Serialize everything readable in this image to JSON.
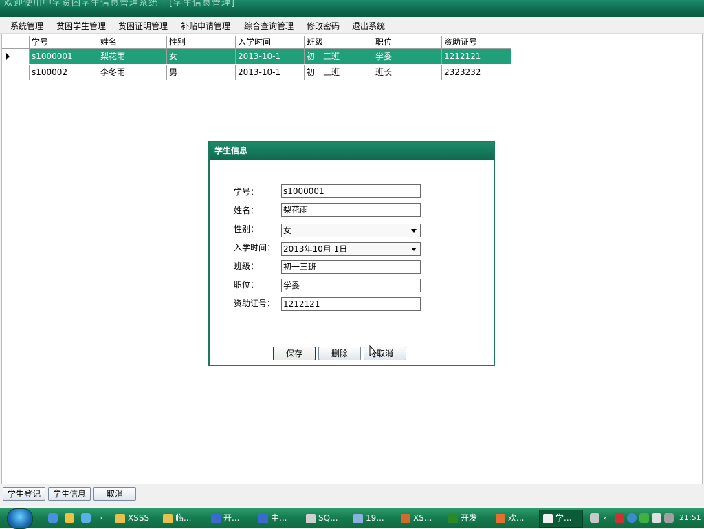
{
  "window": {
    "title": "欢迎使用中学贫困学生信息管理系统 - [学生信息管理]"
  },
  "menu": [
    "系统管理",
    "贫困学生管理",
    "贫困证明管理",
    "补贴申请管理",
    "综合查询管理",
    "修改密码",
    "退出系统"
  ],
  "grid": {
    "columns": [
      "学号",
      "姓名",
      "性别",
      "入学时间",
      "班级",
      "职位",
      "资助证号"
    ],
    "rows": [
      [
        "s1000001",
        "梨花雨",
        "女",
        "2013-10-1",
        "初一三班",
        "学委",
        "1212121"
      ],
      [
        "s100002",
        "李冬雨",
        "男",
        "2013-10-1",
        "初一三班",
        "班长",
        "2323232"
      ]
    ]
  },
  "dialog": {
    "title": "学生信息",
    "labels": [
      "学号：",
      "姓名：",
      "性别：",
      "入学时间：",
      "班级：",
      "职位：",
      "资助证号："
    ],
    "values": [
      "s1000001",
      "梨花雨",
      "女",
      "2013年10月  1日",
      "初一三班",
      "学委",
      "1212121"
    ],
    "buttons": [
      "保存",
      "删除",
      "取消"
    ]
  },
  "bottom_buttons": [
    "学生登记",
    "学生信息",
    "取消"
  ],
  "taskbar": {
    "items": [
      "XSSS",
      "临...",
      "开...",
      "中...",
      "SQ...",
      "19...",
      "XS...",
      "开发",
      "欢...",
      "学..."
    ],
    "clock": "21:51"
  }
}
